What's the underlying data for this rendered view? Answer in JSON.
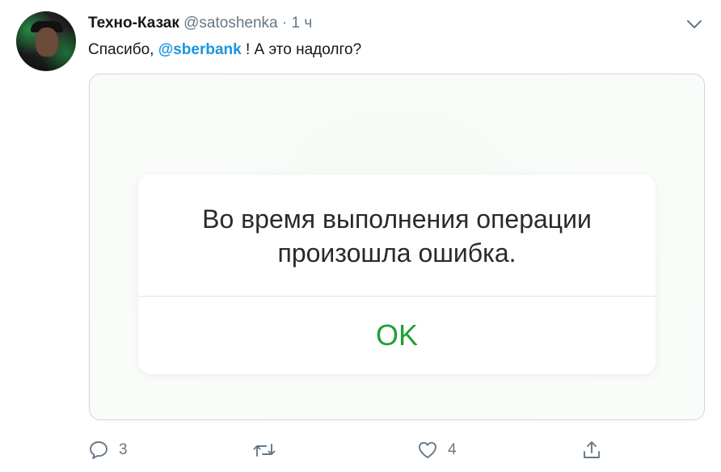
{
  "tweet": {
    "author_name": "Техно-Казак",
    "handle": "@satoshenka",
    "separator": "·",
    "time": "1 ч",
    "text_before": "Спасибо, ",
    "mention": "@sberbank",
    "text_after": " ! А это надолго?"
  },
  "media": {
    "dialog_message": "Во время выполнения операции произошла ошибка.",
    "dialog_button": "OK"
  },
  "actions": {
    "reply_count": "3",
    "retweet_count": "",
    "like_count": "4"
  },
  "icons": {
    "menu": "chevron-down-icon",
    "reply": "reply-icon",
    "retweet": "retweet-icon",
    "like": "heart-icon",
    "share": "share-icon"
  },
  "colors": {
    "link": "#1b95e0",
    "secondary_text": "#657786",
    "ok_green": "#21a038",
    "border": "#ccd6dd"
  }
}
